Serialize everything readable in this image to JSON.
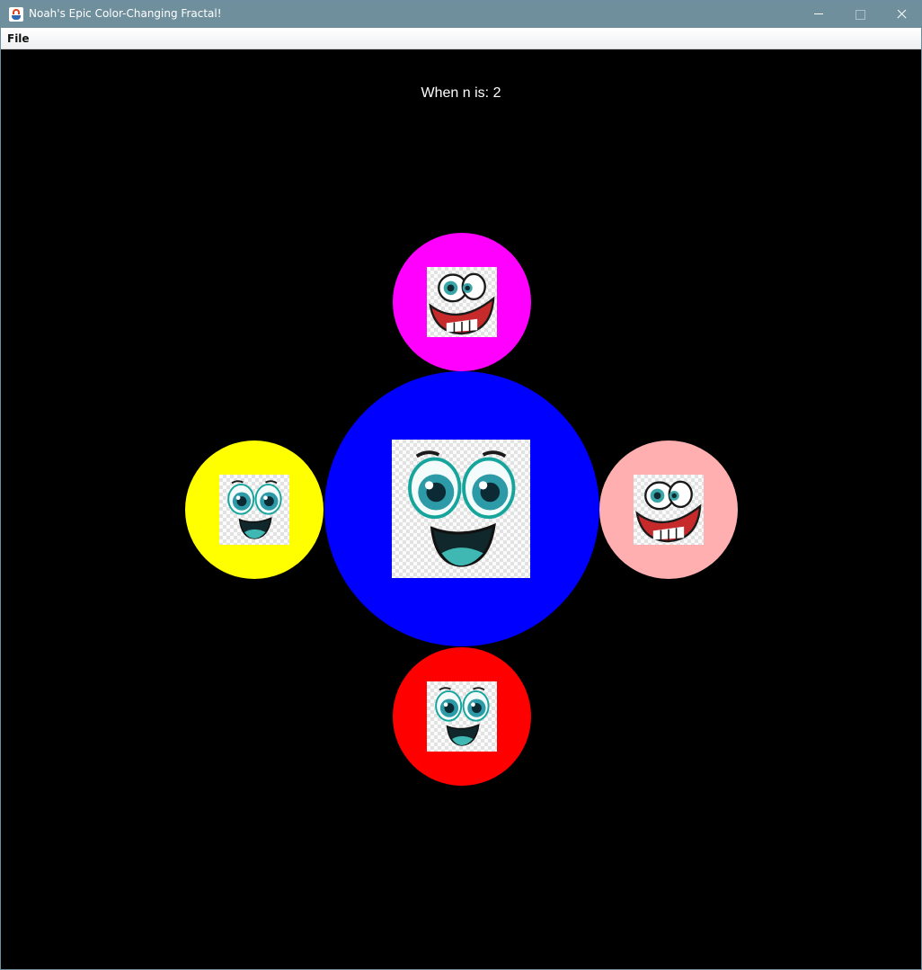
{
  "window": {
    "title": "Noah's Epic Color-Changing Fractal!",
    "controls": [
      "minimize-icon",
      "maximize-icon",
      "close-icon"
    ]
  },
  "menu": {
    "items": [
      {
        "label": "File"
      }
    ]
  },
  "canvas": {
    "background": "#000000",
    "caption": "When n is: 2",
    "n": 2,
    "circles": [
      {
        "position": "center",
        "color": "#0000ff",
        "face": "happy-face-icon"
      },
      {
        "position": "top",
        "color": "#ff00ff",
        "face": "goofy-face-icon"
      },
      {
        "position": "left",
        "color": "#ffff00",
        "face": "happy-face-icon"
      },
      {
        "position": "right",
        "color": "#ffafaf",
        "face": "goofy-face-icon"
      },
      {
        "position": "bottom",
        "color": "#ff0000",
        "face": "happy-face-icon"
      }
    ]
  }
}
